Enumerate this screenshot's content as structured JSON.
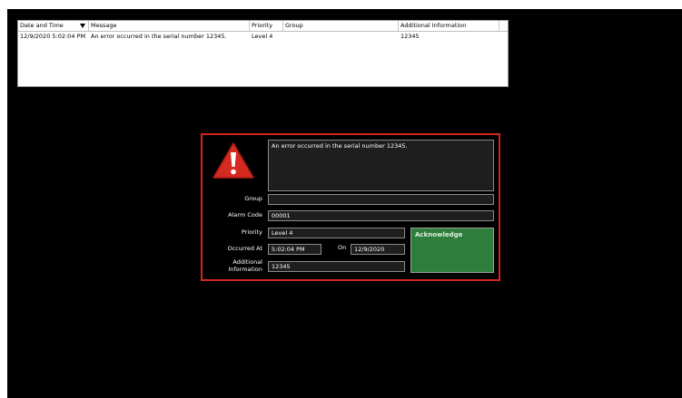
{
  "alarm_table": {
    "columns": [
      "Date and Time",
      "Message",
      "Priority",
      "Group",
      "Additional Information"
    ],
    "rows": [
      {
        "date_time": "12/9/2020 5:02:04 PM",
        "message": "An error occurred in the serial number 12345.",
        "priority": "Level 4",
        "group": "",
        "additional_info": "12345"
      }
    ]
  },
  "alarm_detail": {
    "message": "An error occurred in the serial number 12345.",
    "labels": {
      "group": "Group",
      "alarm_code": "Alarm Code",
      "priority": "Priority",
      "occurred_at": "Occurred At",
      "on": "On",
      "additional_info_line1": "Additional",
      "additional_info_line2": "Information"
    },
    "values": {
      "group": "",
      "alarm_code": "00001",
      "priority": "Level 4",
      "occurred_time": "5:02:04 PM",
      "occurred_date": "12/9/2020",
      "additional_info": "12345"
    },
    "acknowledge_label": "Acknowledge",
    "icon": "warning-triangle-icon"
  },
  "colors": {
    "background": "#000000",
    "panel_border": "#d2261f",
    "acknowledge_button": "#2f7d3c",
    "warning_icon": "#d42a20"
  }
}
